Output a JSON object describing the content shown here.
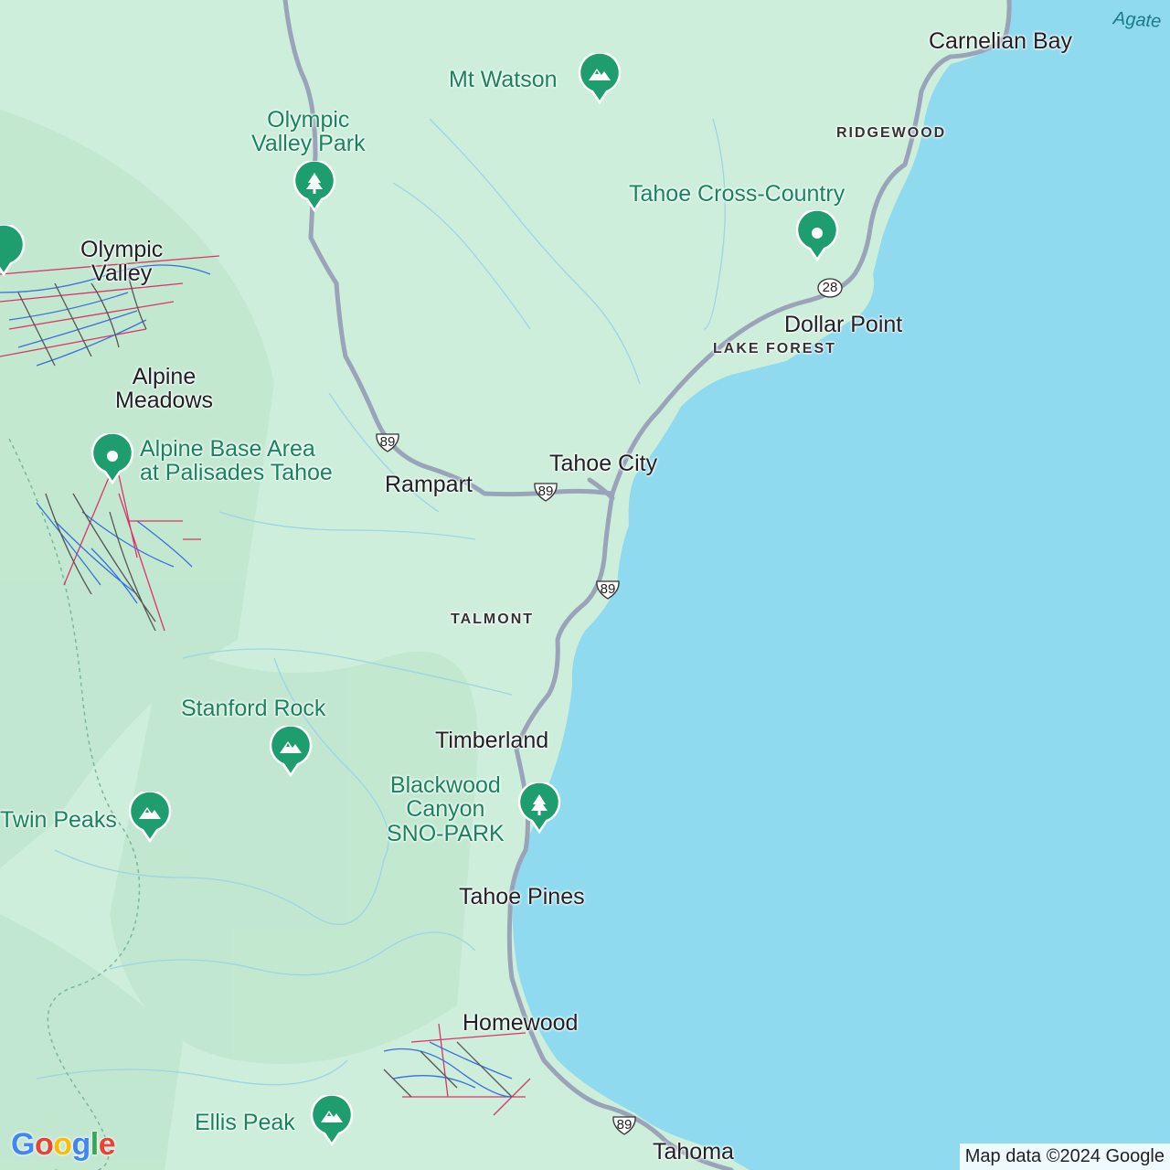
{
  "colors": {
    "land": "#cdeedb",
    "water": "#8fdaee",
    "road": "#9aa4b8",
    "park_pin": "#1e9e6e"
  },
  "places": {
    "carnelian_bay": "Carnelian Bay",
    "olympic_valley": "Olympic\nValley",
    "alpine_meadows": "Alpine\nMeadows",
    "rampart": "Rampart",
    "tahoe_city": "Tahoe City",
    "dollar_point": "Dollar Point",
    "timberland": "Timberland",
    "tahoe_pines": "Tahoe Pines",
    "homewood": "Homewood",
    "tahoma": "Tahoma"
  },
  "neighborhoods": {
    "ridgewood": "RIDGEWOOD",
    "lake_forest": "LAKE FOREST",
    "talmont": "TALMONT"
  },
  "water_labels": {
    "agate": "Agate"
  },
  "pois": {
    "mt_watson": {
      "label": "Mt Watson",
      "icon": "mountain-icon"
    },
    "olympic_valley_park": {
      "label": "Olympic\nValley Park",
      "icon": "tree-icon"
    },
    "tahoe_cross_country": {
      "label": "Tahoe Cross-Country",
      "icon": "dot-icon"
    },
    "alpine_base_area": {
      "label": "Alpine Base Area\nat Palisades Tahoe",
      "icon": "dot-icon"
    },
    "stanford_rock": {
      "label": "Stanford Rock",
      "icon": "mountain-icon"
    },
    "twin_peaks": {
      "label": "Twin Peaks",
      "icon": "mountain-icon"
    },
    "blackwood_canyon": {
      "label": "Blackwood\nCanyon\nSNO-PARK",
      "icon": "tree-icon"
    },
    "ellis_peak": {
      "label": "Ellis Peak",
      "icon": "mountain-icon"
    }
  },
  "route_shields": {
    "hwy89": "89",
    "hwy28": "28"
  },
  "attribution": "Map data ©2024 Google",
  "logo": "Google"
}
